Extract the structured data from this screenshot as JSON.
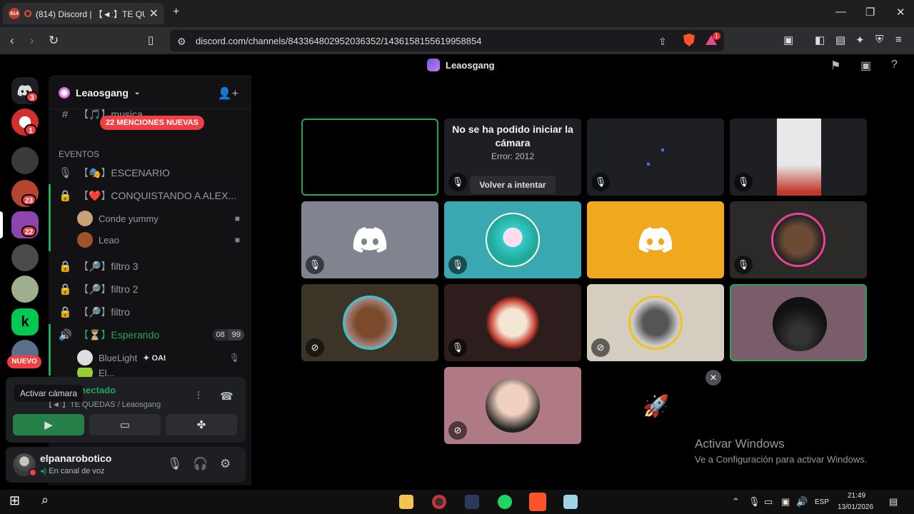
{
  "browser": {
    "tab_favicon_badge": "814",
    "tab_title": "(814) Discord | 【◄ː】TE QUE",
    "url": "discord.com/channels/843364802952036352/1436158155619958854",
    "rewards_badge": "1"
  },
  "discord_top": {
    "server_name": "Leaosgang"
  },
  "rail": {
    "badges": [
      "3",
      "1",
      "23",
      "22"
    ],
    "new_label": "NUEVO"
  },
  "sidebar": {
    "server_name": "Leaosgang",
    "mentions_pill": "22 MENCIONES NUEVAS",
    "partial_channel": "【🎵】musica",
    "category": "EVENTOS",
    "channels": [
      {
        "icon": "🎙",
        "label": "【🎭】ESCENARIO"
      },
      {
        "icon": "🔒",
        "label": "【❤️】CONQUISTANDO A ALEX..."
      },
      {
        "icon": "🔒",
        "label": "【🔎】filtro 3"
      },
      {
        "icon": "🔒",
        "label": "【🔎】filtro 2"
      },
      {
        "icon": "🔒",
        "label": "【🔎】filtro"
      },
      {
        "icon": "🔊",
        "label": "【⏳】Esperando",
        "count_a": "08",
        "count_b": "99"
      }
    ],
    "conquistando_users": [
      {
        "name": "Conde yummy"
      },
      {
        "name": "Leao"
      }
    ],
    "esperando_users": [
      {
        "name": "BlueLight",
        "tag": "✦ OAI"
      },
      {
        "name": "El..."
      }
    ]
  },
  "voice_panel": {
    "tooltip": "Activar cámara",
    "title": "Vídeo conectado",
    "subtitle": "【◄ː】TE QUEDAS / Leaosgang"
  },
  "account": {
    "username": "elpanarobotico",
    "status": "En canal de voz"
  },
  "video": {
    "error_title": "No se ha podido iniciar la cámara",
    "error_code": "Error: 2012",
    "retry_label": "Volver a intentar"
  },
  "windows_activation": {
    "title": "Activar Windows",
    "subtitle": "Ve a Configuración para activar Windows."
  },
  "taskbar": {
    "lang": "ESP",
    "time": "21:49",
    "date": "13/01/2026"
  },
  "colors": {
    "discord_blurple": "#5865f2",
    "speaking_green": "#23a55a",
    "mention_red": "#f23f43"
  }
}
